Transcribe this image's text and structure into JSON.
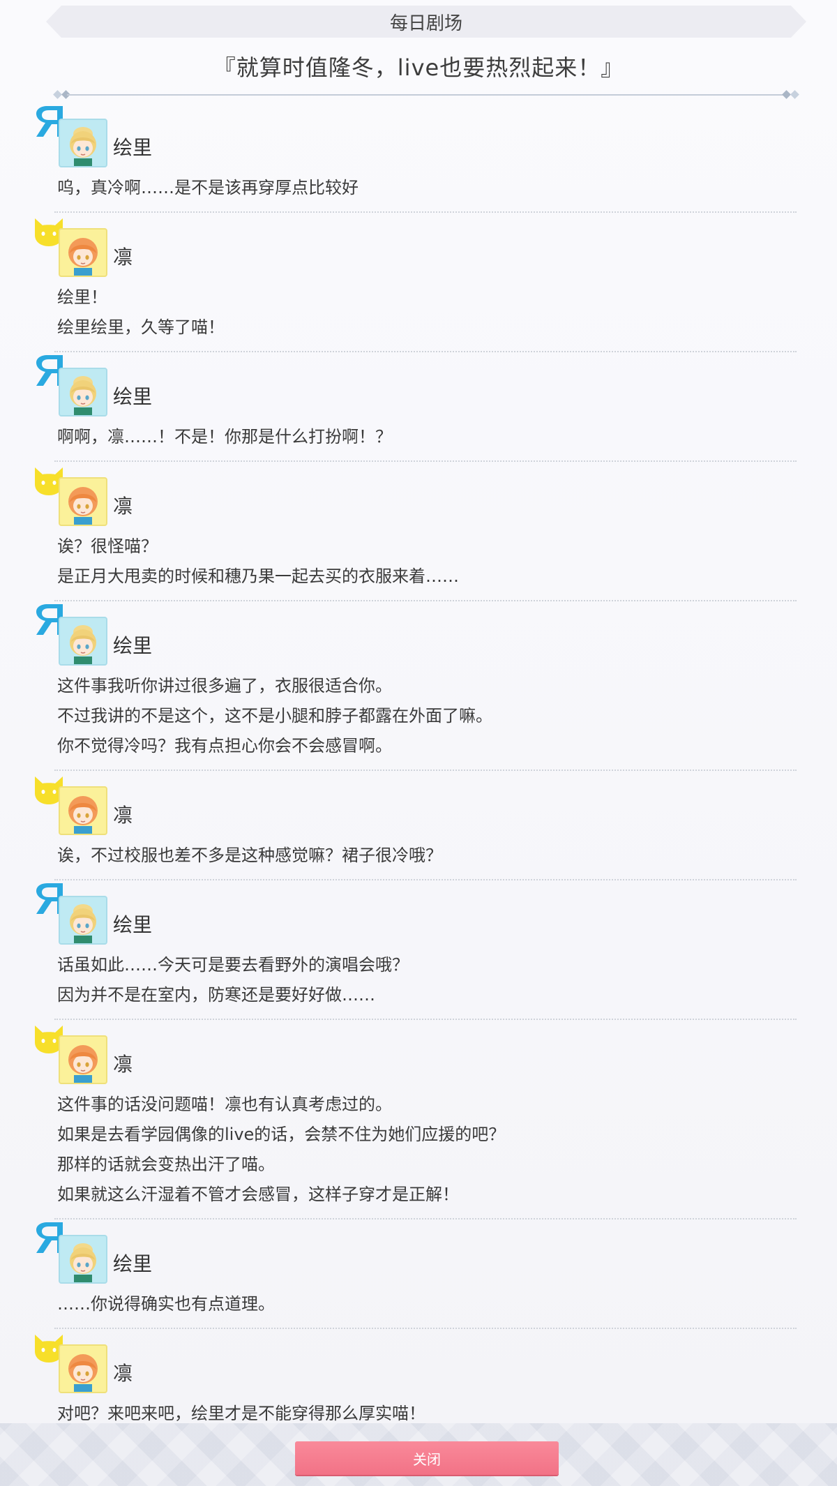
{
  "header": {
    "title": "每日剧场"
  },
  "story": {
    "title": "『就算时值隆冬，live也要热烈起来！』"
  },
  "dialogue": [
    {
      "speaker": "绘里",
      "character": "eli",
      "emblem": "eli-emblem-icon",
      "lines": [
        "呜，真冷啊……是不是该再穿厚点比较好"
      ]
    },
    {
      "speaker": "凛",
      "character": "rin",
      "emblem": "cat-emblem-icon",
      "lines": [
        "绘里！",
        "绘里绘里，久等了喵！"
      ]
    },
    {
      "speaker": "绘里",
      "character": "eli",
      "emblem": "eli-emblem-icon",
      "lines": [
        "啊啊，凛……！不是！你那是什么打扮啊！？"
      ]
    },
    {
      "speaker": "凛",
      "character": "rin",
      "emblem": "cat-emblem-icon",
      "lines": [
        "诶？很怪喵？",
        "是正月大甩卖的时候和穗乃果一起去买的衣服来着……"
      ]
    },
    {
      "speaker": "绘里",
      "character": "eli",
      "emblem": "eli-emblem-icon",
      "lines": [
        "这件事我听你讲过很多遍了，衣服很适合你。",
        "不过我讲的不是这个，这不是小腿和脖子都露在外面了嘛。",
        "你不觉得冷吗？我有点担心你会不会感冒啊。"
      ]
    },
    {
      "speaker": "凛",
      "character": "rin",
      "emblem": "cat-emblem-icon",
      "lines": [
        "诶，不过校服也差不多是这种感觉嘛？裙子很冷哦？"
      ]
    },
    {
      "speaker": "绘里",
      "character": "eli",
      "emblem": "eli-emblem-icon",
      "lines": [
        "话虽如此……今天可是要去看野外的演唱会哦？",
        "因为并不是在室内，防寒还是要好好做……"
      ]
    },
    {
      "speaker": "凛",
      "character": "rin",
      "emblem": "cat-emblem-icon",
      "lines": [
        "这件事的话没问题喵！凛也有认真考虑过的。",
        "如果是去看学园偶像的live的话，会禁不住为她们应援的吧？",
        "那样的话就会变热出汗了喵。",
        "如果就这么汗湿着不管才会感冒，这样子穿才是正解！"
      ]
    },
    {
      "speaker": "绘里",
      "character": "eli",
      "emblem": "eli-emblem-icon",
      "lines": [
        "……你说得确实也有点道理。"
      ]
    },
    {
      "speaker": "凛",
      "character": "rin",
      "emblem": "cat-emblem-icon",
      "lines": [
        "对吧？来吧来吧，绘里才是不能穿得那么厚实喵！"
      ]
    }
  ],
  "footer": {
    "close_label": "关闭"
  },
  "colors": {
    "eli_emblem": "#2aa9e0",
    "rin_emblem": "#f7df2a",
    "close_button": "#f47d8f"
  }
}
